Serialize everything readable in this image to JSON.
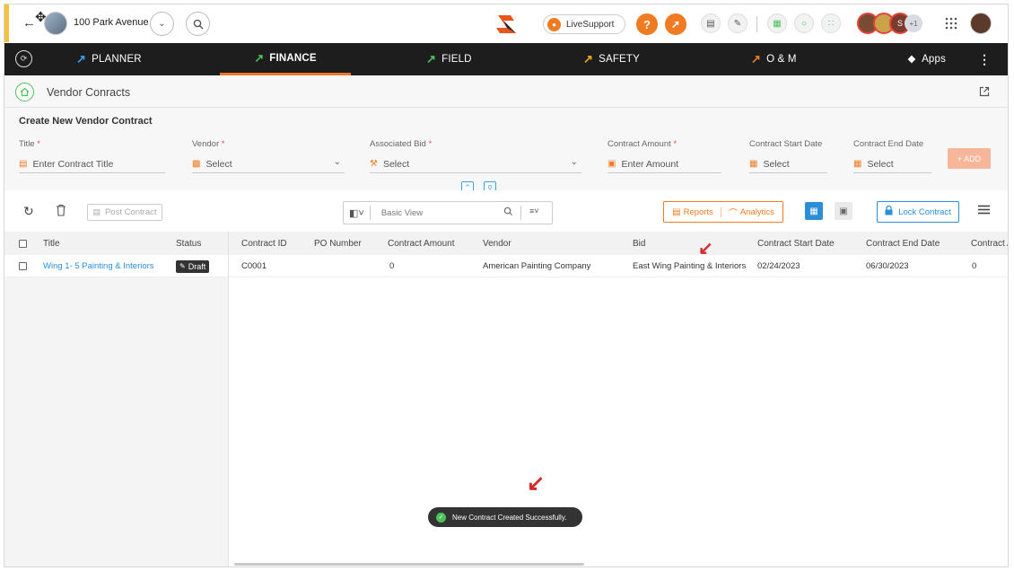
{
  "topbar": {
    "project_name": "100 Park Avenue",
    "live_support_label": "LiveSupport",
    "avatar_more_count": "+1",
    "avatar_letter": "S",
    "help_icon": "?"
  },
  "nav": {
    "items": [
      {
        "label": "PLANNER",
        "color": "#3ba0f0"
      },
      {
        "label": "FINANCE",
        "color": "#4ec25a"
      },
      {
        "label": "FIELD",
        "color": "#4ec25a"
      },
      {
        "label": "SAFETY",
        "color": "#f5a623"
      },
      {
        "label": "O & M",
        "color": "#f07b22"
      },
      {
        "label": "Apps",
        "color": "#ffffff"
      }
    ],
    "active": "FINANCE"
  },
  "page": {
    "title": "Vendor Conracts"
  },
  "form": {
    "heading": "Create New Vendor Contract",
    "title_label": "Title",
    "title_placeholder": "Enter Contract Title",
    "vendor_label": "Vendor",
    "vendor_value": "Select",
    "bid_label": "Associated Bid",
    "bid_value": "Select",
    "amount_label": "Contract Amount",
    "amount_placeholder": "Enter Amount",
    "start_label": "Contract Start Date",
    "start_value": "Select",
    "end_label": "Contract End Date",
    "end_value": "Select",
    "required_mark": "*",
    "add_label": "+ ADD"
  },
  "toolbar": {
    "post_contract_label": "Post Contract",
    "view_label": "Basic View",
    "reports_label": "Reports",
    "analytics_label": "Analytics",
    "lock_contract_label": "Lock Contract"
  },
  "table": {
    "columns": [
      "Title",
      "Status",
      "Contract ID",
      "PO Number",
      "Contract Amount",
      "Vendor",
      "Bid",
      "Contract Start Date",
      "Contract End Date",
      "Contract A"
    ],
    "rows": [
      {
        "title": "Wing 1- 5 Painting & Interiors",
        "status": "Draft",
        "contract_id": "C0001",
        "po_number": "",
        "amount": "0",
        "vendor": "American Painting Company",
        "bid": "East Wing Painting & Interiors",
        "start": "02/24/2023",
        "end": "06/30/2023",
        "contract_a": "0"
      }
    ]
  },
  "toast": {
    "message": "New Contract Created Successfully."
  },
  "colors": {
    "accent_orange": "#f07b22",
    "link_blue": "#2a8fd6",
    "nav_bg": "#1d1d1d",
    "annotation_red": "#d42a2a"
  }
}
